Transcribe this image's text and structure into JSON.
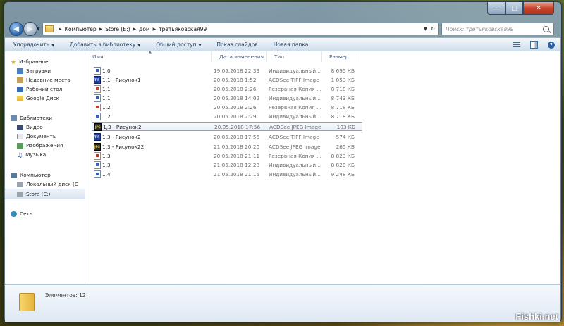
{
  "window": {
    "caption": {
      "minimize": "–",
      "maximize": "□",
      "close": "✕"
    }
  },
  "address": {
    "crumbs": [
      "Компьютер",
      "Store (E:)",
      "дом",
      "третьяковская99"
    ],
    "search_placeholder": "Поиск: третьяковская99"
  },
  "toolbar": {
    "organize": "Упорядочить",
    "add_to_library": "Добавить в библиотеку",
    "share": "Общий доступ",
    "slideshow": "Показ слайдов",
    "new_folder": "Новая папка"
  },
  "nav": {
    "favorites": "Избранное",
    "downloads": "Загрузки",
    "recent": "Недавние места",
    "desktop": "Рабочий стол",
    "google_drive": "Google Диск",
    "libraries": "Библиотеки",
    "video": "Видео",
    "documents": "Документы",
    "pictures": "Изображения",
    "music": "Музыка",
    "computer": "Компьютер",
    "local_disk": "Локальный диск (C",
    "store": "Store (E:)",
    "network": "Сеть"
  },
  "columns": {
    "name": "Имя",
    "date": "Дата изменения",
    "type": "Тип",
    "size": "Размер"
  },
  "files": [
    {
      "name": "1,0",
      "date": "19.05.2018 22:39",
      "type": "Индивидуальный...",
      "size": "8 695 КБ",
      "icon": "doc"
    },
    {
      "name": "1,1 - Рисунок1",
      "date": "20.05.2018 1:52",
      "type": "ACDSee TIFF Image",
      "size": "1 053 КБ",
      "icon": "tif"
    },
    {
      "name": "1,1",
      "date": "20.05.2018 2:26",
      "type": "Резервная Копия ...",
      "size": "8 718 КБ",
      "icon": "bak"
    },
    {
      "name": "1,1",
      "date": "20.05.2018 14:02",
      "type": "Индивидуальный...",
      "size": "8 743 КБ",
      "icon": "doc"
    },
    {
      "name": "1,2",
      "date": "20.05.2018 2:26",
      "type": "Резервная Копия ...",
      "size": "8 718 КБ",
      "icon": "bak"
    },
    {
      "name": "1,2",
      "date": "20.05.2018 2:29",
      "type": "Индивидуальный...",
      "size": "8 718 КБ",
      "icon": "doc"
    },
    {
      "name": "1,3 - Рисунок2",
      "date": "20.05.2018 17:56",
      "type": "ACDSee JPEG Image",
      "size": "103 КБ",
      "icon": "jpg"
    },
    {
      "name": "1,3 - Рисунок2",
      "date": "20.05.2018 17:56",
      "type": "ACDSee TIFF Image",
      "size": "574 КБ",
      "icon": "tif"
    },
    {
      "name": "1,3 - Рисунок22",
      "date": "21.05.2018 20:20",
      "type": "ACDSee JPEG Image",
      "size": "265 КБ",
      "icon": "jpg"
    },
    {
      "name": "1,3",
      "date": "20.05.2018 21:11",
      "type": "Резервная Копия ...",
      "size": "8 823 КБ",
      "icon": "bak"
    },
    {
      "name": "1,3",
      "date": "21.05.2018 12:28",
      "type": "Индивидуальный...",
      "size": "8 820 КБ",
      "icon": "doc"
    },
    {
      "name": "1,4",
      "date": "21.05.2018 21:15",
      "type": "Индивидуальный...",
      "size": "9 248 КБ",
      "icon": "doc"
    }
  ],
  "status": {
    "items_count": "Элементов: 12"
  },
  "watermark": "Fishki.net"
}
